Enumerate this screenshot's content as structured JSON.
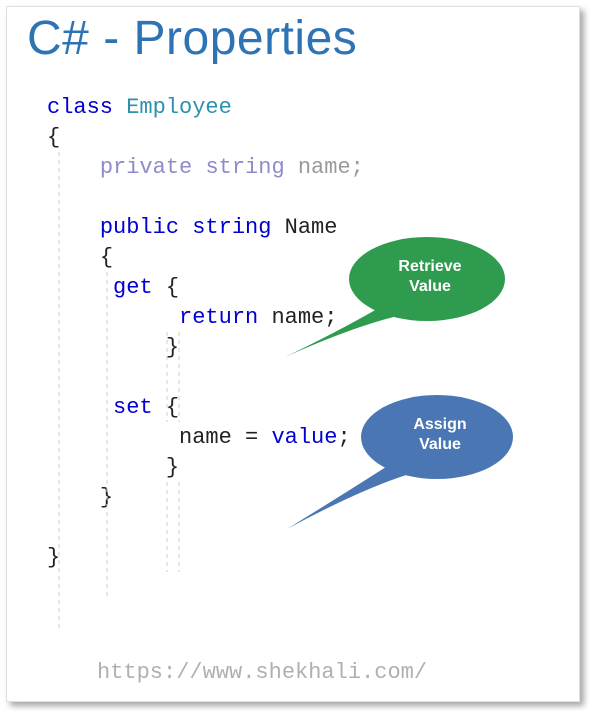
{
  "title": "C# - Properties",
  "code": {
    "class_kw": "class",
    "class_name": "Employee",
    "open_brace": "{",
    "field_access": "private",
    "field_type": "string",
    "field_name": "name",
    "field_semi": ";",
    "prop_access": "public",
    "prop_type": "string",
    "prop_name": "Name",
    "get_kw": "get",
    "return_kw": "return",
    "return_id": "name",
    "return_semi": ";",
    "set_kw": "set",
    "assign_target": "name",
    "equals": "=",
    "value_kw": "value",
    "assign_semi": ";",
    "close_brace": "}"
  },
  "callouts": {
    "retrieve": {
      "line1": "Retrieve",
      "line2": "Value",
      "color": "#2E9B4F"
    },
    "assign": {
      "line1": "Assign",
      "line2": "Value",
      "color": "#4A77B4"
    }
  },
  "footer": "https://www.shekhali.com/"
}
